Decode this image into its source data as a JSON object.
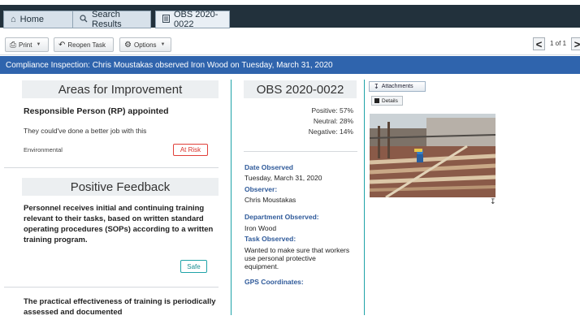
{
  "tabs": [
    {
      "label": "Home",
      "icon": "home-icon"
    },
    {
      "label": "Search Results",
      "icon": "search-icon"
    },
    {
      "label": "OBS 2020-0022",
      "icon": "document-icon"
    }
  ],
  "toolbar": {
    "print_label": "Print",
    "reopen_label": "Reopen Task",
    "options_label": "Options",
    "pager_text": "1 of 1"
  },
  "banner": {
    "title": "Compliance Inspection: Chris Moustakas observed Iron Wood on Tuesday, March 31, 2020"
  },
  "areas_for_improvement": {
    "heading": "Areas for Improvement",
    "item": {
      "title": "Responsible Person (RP) appointed",
      "description": "They could've done a better job with this",
      "category": "Environmental",
      "status": "At Risk"
    }
  },
  "positive_feedback": {
    "heading": "Positive Feedback",
    "items": [
      {
        "text": "Personnel receives initial and continuing training relevant to their tasks, based on written standard operating procedures (SOPs) according to a written training program.",
        "status": "Safe"
      },
      {
        "text": "The practical effectiveness of training is periodically assessed and documented"
      }
    ]
  },
  "observation": {
    "id": "OBS 2020-0022",
    "positive": "Positive: 57%",
    "neutral": "Neutral: 28%",
    "negative": "Negative: 14%",
    "date_label": "Date Observed",
    "date_value": "Tuesday, March 31, 2020",
    "observer_label": "Observer:",
    "observer_value": "Chris Moustakas",
    "department_label": "Department Observed:",
    "department_value": "Iron Wood",
    "task_label": "Task Observed:",
    "task_value": "Wanted to make sure that workers use personal protective equipment.",
    "gps_label": "GPS Coordinates:"
  },
  "attachments": {
    "button_label": "Attachments",
    "details_label": "Details"
  },
  "colors": {
    "banner": "#2f64ad",
    "topbar": "#22313c",
    "at_risk": "#d9332d",
    "safe": "#1a8d92",
    "label_blue": "#2f5a9a"
  }
}
